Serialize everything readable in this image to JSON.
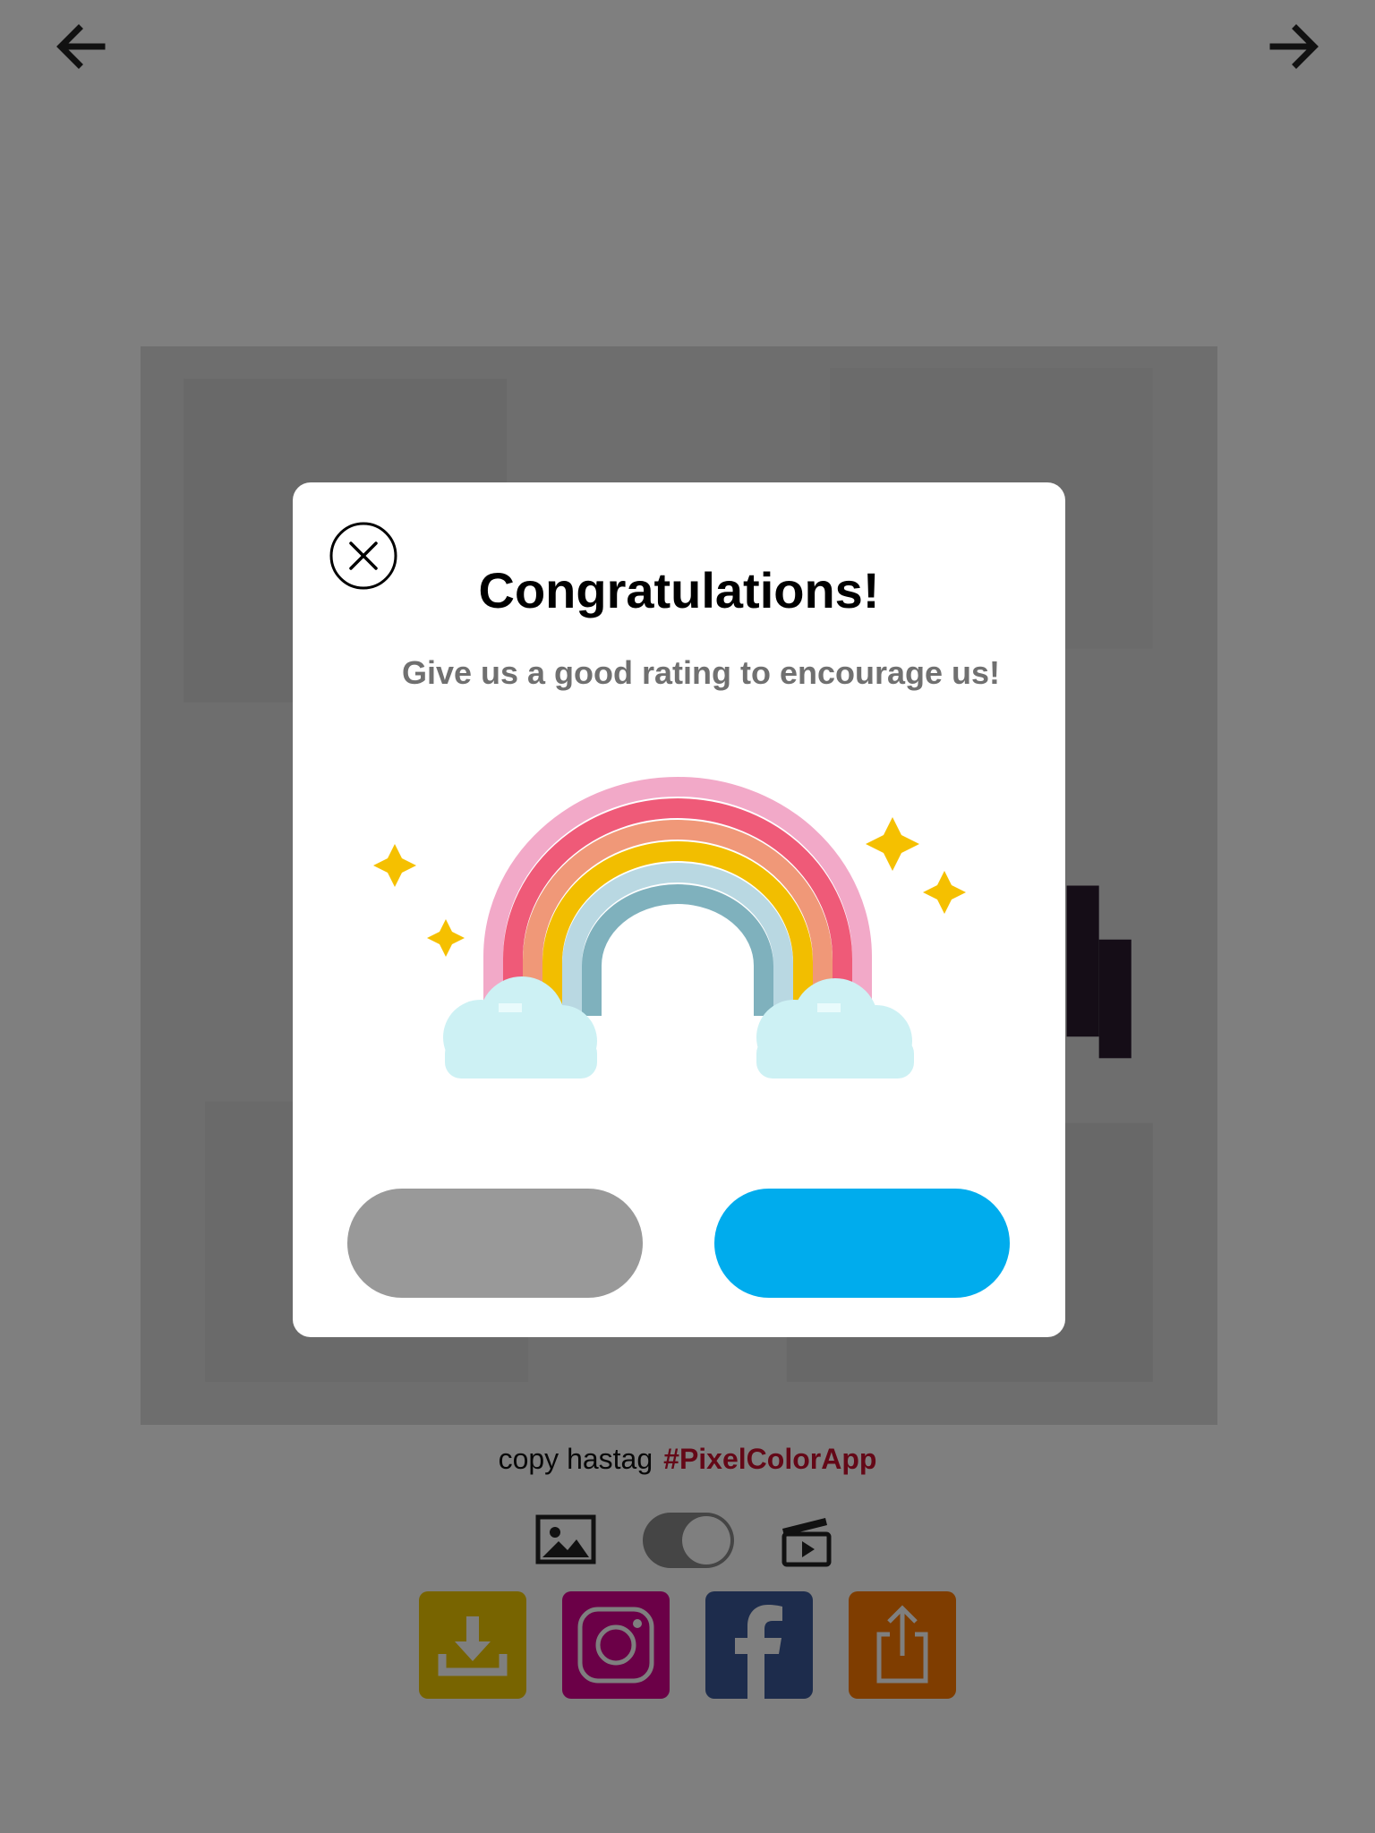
{
  "navigation": {
    "back_icon": "arrow-left-icon",
    "forward_icon": "arrow-right-icon"
  },
  "share_panel": {
    "hashtag_prefix": "copy hastag",
    "hashtag": "#PixelColorApp",
    "media_toggle": {
      "left_icon": "image-icon",
      "right_icon": "video-clapper-icon",
      "state": "on"
    },
    "buttons": [
      {
        "name": "download",
        "icon": "download-icon",
        "color": "#f0c800"
      },
      {
        "name": "instagram",
        "icon": "instagram-icon",
        "color": "#d6008e"
      },
      {
        "name": "facebook",
        "icon": "facebook-icon",
        "color": "#3b5998"
      },
      {
        "name": "share",
        "icon": "share-icon",
        "color": "#ff7a00"
      }
    ]
  },
  "dialog": {
    "title": "Congratulations!",
    "subtitle": "Give us a good rating to encourage us!",
    "close_icon": "close-circle-icon",
    "illustration": "pixel-rainbow-with-clouds-and-sparkles",
    "later_button_label": "",
    "rate_button_label": "",
    "colors": {
      "later_button": "#999999",
      "rate_button": "#00aced"
    }
  }
}
